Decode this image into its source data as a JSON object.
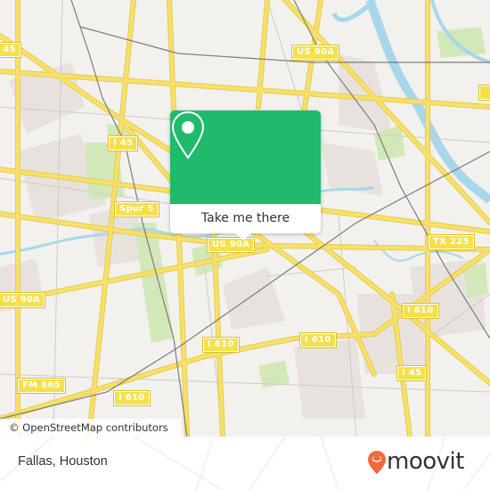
{
  "map": {
    "city": "Houston",
    "colors": {
      "land": "#f2f1ed",
      "road": "#f7e06a",
      "road_casing": "#e5cd4e",
      "water": "#a8d7ea",
      "park": "#d3e8b8",
      "block": "#e8e2df",
      "rail": "#7d7d7d",
      "minor_road": "#cfcbc5"
    },
    "road_shields": [
      {
        "label": "I 45",
        "id": "i45-north"
      },
      {
        "label": "US 90A",
        "id": "us90a-northeast"
      },
      {
        "label": "Spur 5",
        "id": "spur5"
      },
      {
        "label": "US 90A",
        "id": "us90a-center"
      },
      {
        "label": "US 90A",
        "id": "us90a-west"
      },
      {
        "label": "TX 225",
        "id": "tx225"
      },
      {
        "label": "I 610",
        "id": "i610-east"
      },
      {
        "label": "I 610",
        "id": "i610-center"
      },
      {
        "label": "I 610",
        "id": "i610-southwest"
      },
      {
        "label": "I 45",
        "id": "i45-south"
      },
      {
        "label": "FM 865",
        "id": "fm865"
      },
      {
        "label": "45",
        "id": "i45-northwest-partial"
      }
    ],
    "attribution": "© OpenStreetMap contributors"
  },
  "popup": {
    "button_label": "Take me there",
    "accent_color": "#1fba6c",
    "icon": "map-pin-icon"
  },
  "footer": {
    "place_name": "Fallas, Houston",
    "brand": "moovit",
    "brand_color": "#f06a3b"
  }
}
